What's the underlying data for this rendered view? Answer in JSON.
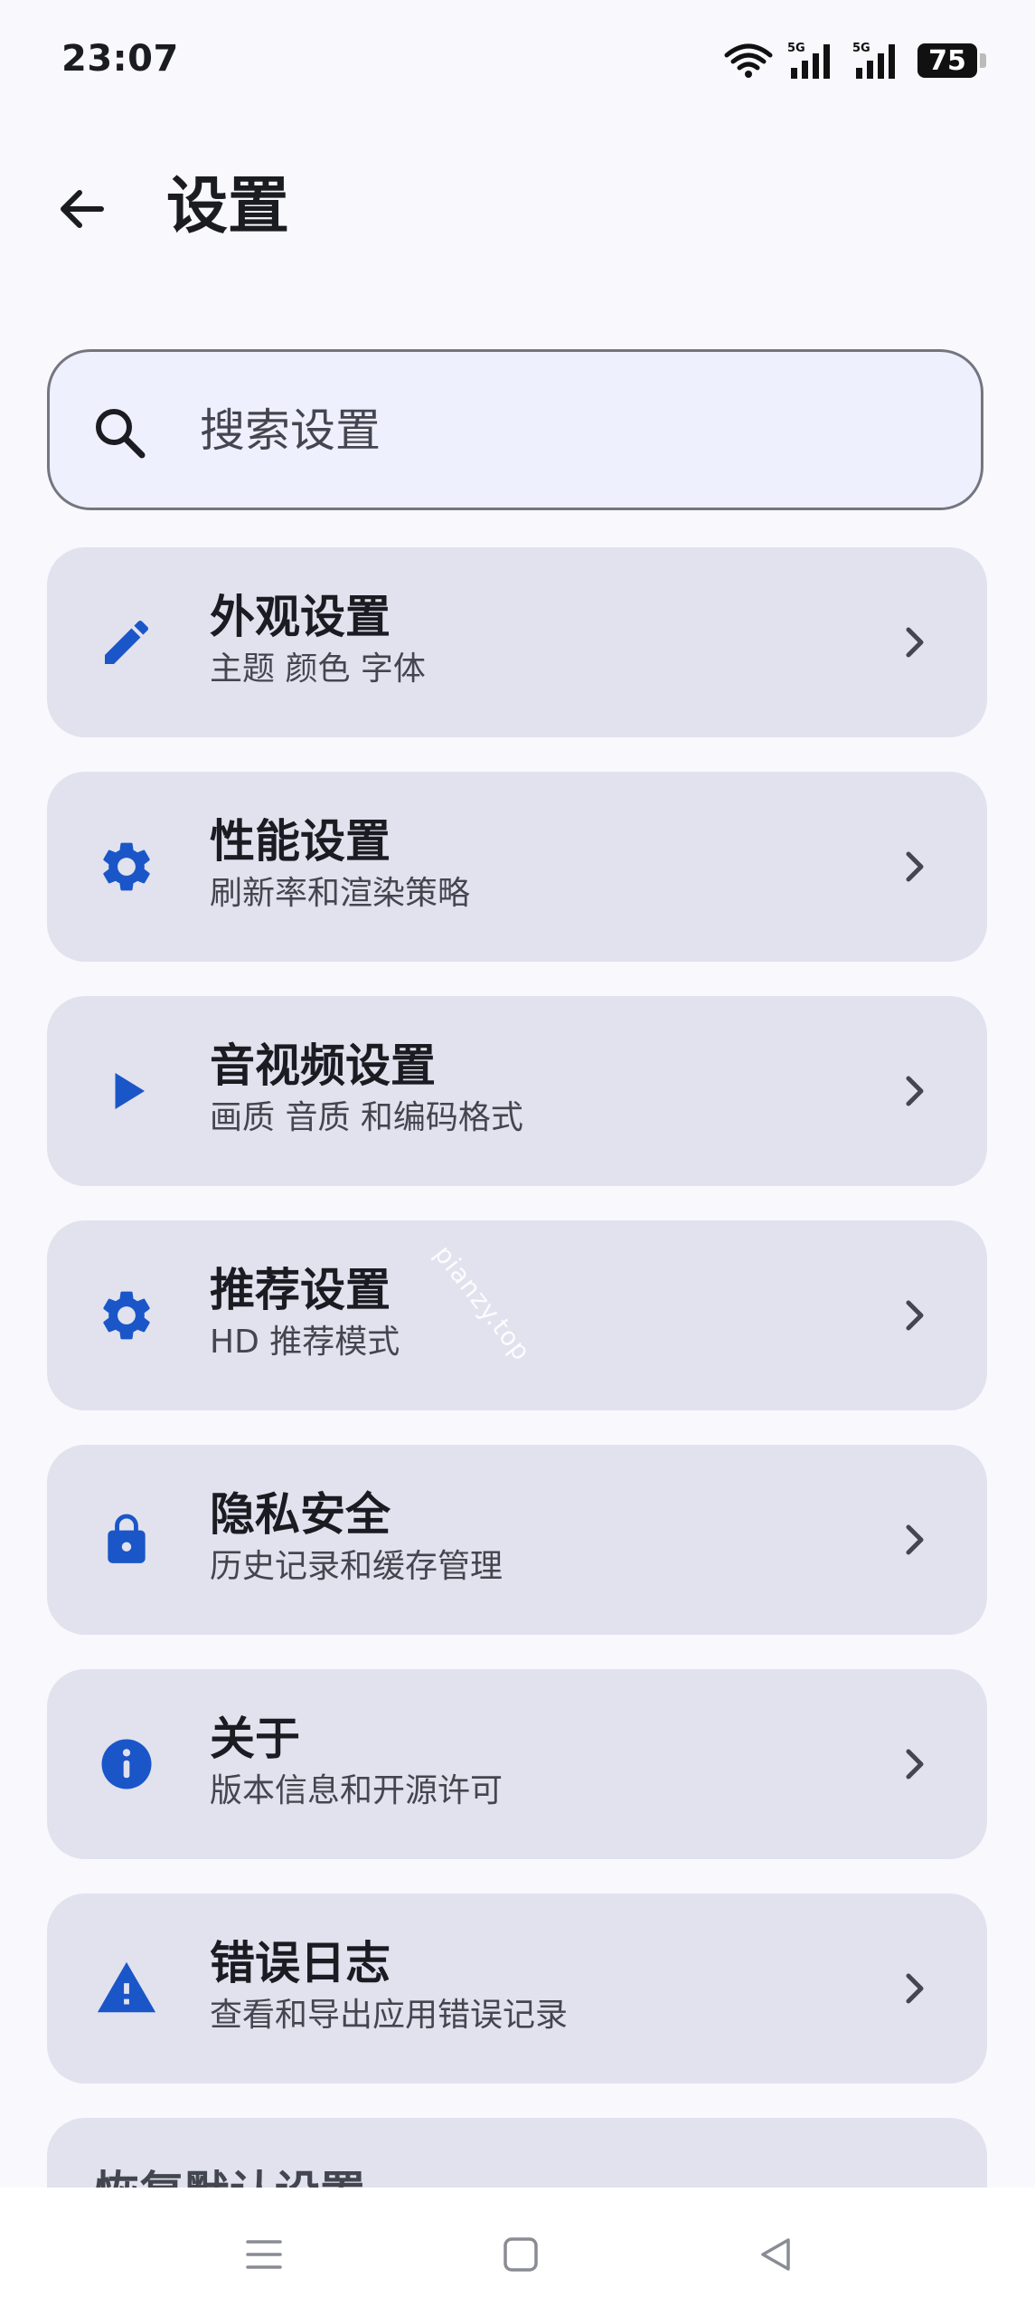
{
  "status_bar": {
    "time": "23:07",
    "network_1": "5G",
    "network_2": "5G",
    "battery": "75"
  },
  "header": {
    "title": "设置"
  },
  "search": {
    "placeholder": "搜索设置"
  },
  "settings": [
    {
      "title": "外观设置",
      "subtitle": "主题 颜色 字体",
      "icon": "pencil-icon"
    },
    {
      "title": "性能设置",
      "subtitle": "刷新率和渲染策略",
      "icon": "gear-icon"
    },
    {
      "title": "音视频设置",
      "subtitle": "画质 音质 和编码格式",
      "icon": "play-icon"
    },
    {
      "title": "推荐设置",
      "subtitle": "HD 推荐模式",
      "icon": "gear-icon"
    },
    {
      "title": "隐私安全",
      "subtitle": "历史记录和缓存管理",
      "icon": "lock-icon"
    },
    {
      "title": "关于",
      "subtitle": "版本信息和开源许可",
      "icon": "info-icon"
    },
    {
      "title": "错误日志",
      "subtitle": "查看和导出应用错误记录",
      "icon": "warning-icon"
    },
    {
      "title": "恢复默认设置"
    }
  ],
  "watermark": "pianzy.top",
  "colors": {
    "accent": "#1a56c8",
    "card": "#e1e2ee",
    "background": "#f8f8fd"
  }
}
